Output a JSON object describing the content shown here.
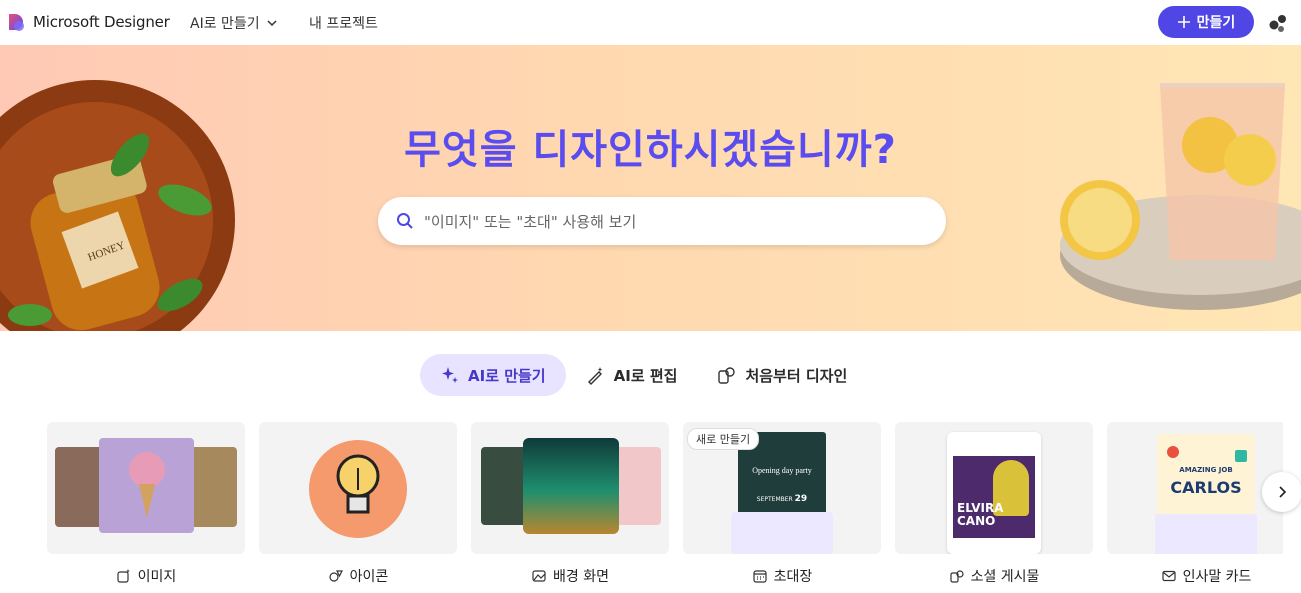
{
  "header": {
    "brand": "Microsoft Designer",
    "nav_ai_create": "AI로 만들기",
    "nav_projects": "내 프로젝트",
    "create_button": "만들기"
  },
  "hero": {
    "title": "무엇을 디자인하시겠습니까?",
    "search_placeholder": "\"이미지\" 또는 \"초대\" 사용해 보기",
    "left_image_label": "HONEY"
  },
  "tabs": [
    {
      "label": "AI로 만들기",
      "active": true
    },
    {
      "label": "AI로 편집",
      "active": false
    },
    {
      "label": "처음부터 디자인",
      "active": false
    }
  ],
  "cards": [
    {
      "label": "이미지",
      "icon": "image-sparkle-icon"
    },
    {
      "label": "아이콘",
      "icon": "icon-shapes-icon"
    },
    {
      "label": "배경 화면",
      "icon": "wallpaper-icon"
    },
    {
      "label": "초대장",
      "icon": "calendar-icon",
      "badge": "새로 만들기",
      "preview": {
        "title": "Opening day party",
        "month": "SEPTEMBER",
        "day": "29"
      }
    },
    {
      "label": "소셜 게시물",
      "icon": "social-post-icon",
      "preview": {
        "name": "ELVIRA CANO"
      }
    },
    {
      "label": "인사말 카드",
      "icon": "mail-icon",
      "preview": {
        "line1": "AMAZING JOB",
        "line2": "CARLOS"
      }
    }
  ],
  "colors": {
    "accent": "#4f46e5",
    "title": "#5b4cf0",
    "active_tab_bg": "#e8e4ff"
  }
}
